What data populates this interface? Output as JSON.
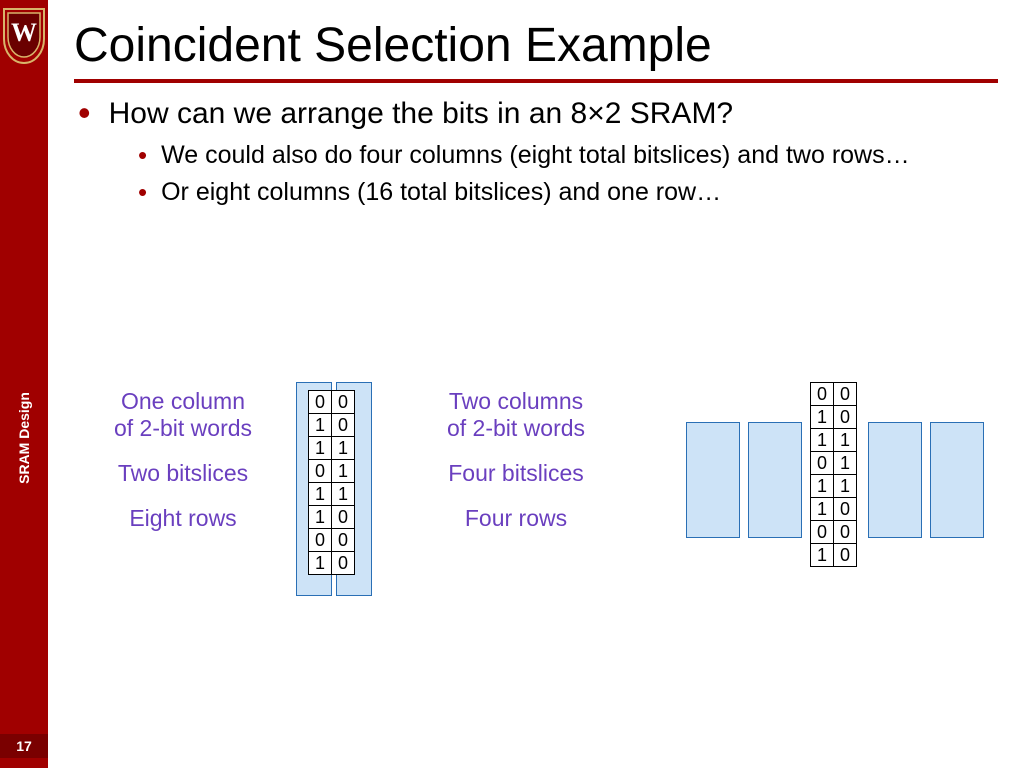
{
  "sidebar": {
    "label": "SRAM Design",
    "page_number": "17"
  },
  "title": "Coincident Selection Example",
  "bullets": {
    "main": "How can we arrange the bits in an 8×2 SRAM?",
    "subs": [
      "We could also do four columns (eight total bitslices) and two rows…",
      "Or eight columns (16 total bitslices) and one row…"
    ]
  },
  "diagrams": {
    "left": {
      "lines": [
        "One column",
        "of 2-bit words",
        "",
        "Two bitslices",
        "",
        "Eight rows"
      ]
    },
    "right": {
      "lines": [
        "Two columns",
        "of 2-bit words",
        "",
        "Four bitslices",
        "",
        "Four rows"
      ]
    }
  },
  "chart_data": {
    "type": "table",
    "title": "SRAM bit arrangements",
    "left_table": {
      "columns": 2,
      "rows": 8,
      "cells": [
        [
          "0",
          "0"
        ],
        [
          "1",
          "0"
        ],
        [
          "1",
          "1"
        ],
        [
          "0",
          "1"
        ],
        [
          "1",
          "1"
        ],
        [
          "1",
          "0"
        ],
        [
          "0",
          "0"
        ],
        [
          "1",
          "0"
        ]
      ]
    },
    "right_table": {
      "columns": 2,
      "rows": 8,
      "cells": [
        [
          "0",
          "0"
        ],
        [
          "1",
          "0"
        ],
        [
          "1",
          "1"
        ],
        [
          "0",
          "1"
        ],
        [
          "1",
          "1"
        ],
        [
          "1",
          "0"
        ],
        [
          "0",
          "0"
        ],
        [
          "1",
          "0"
        ]
      ]
    }
  }
}
